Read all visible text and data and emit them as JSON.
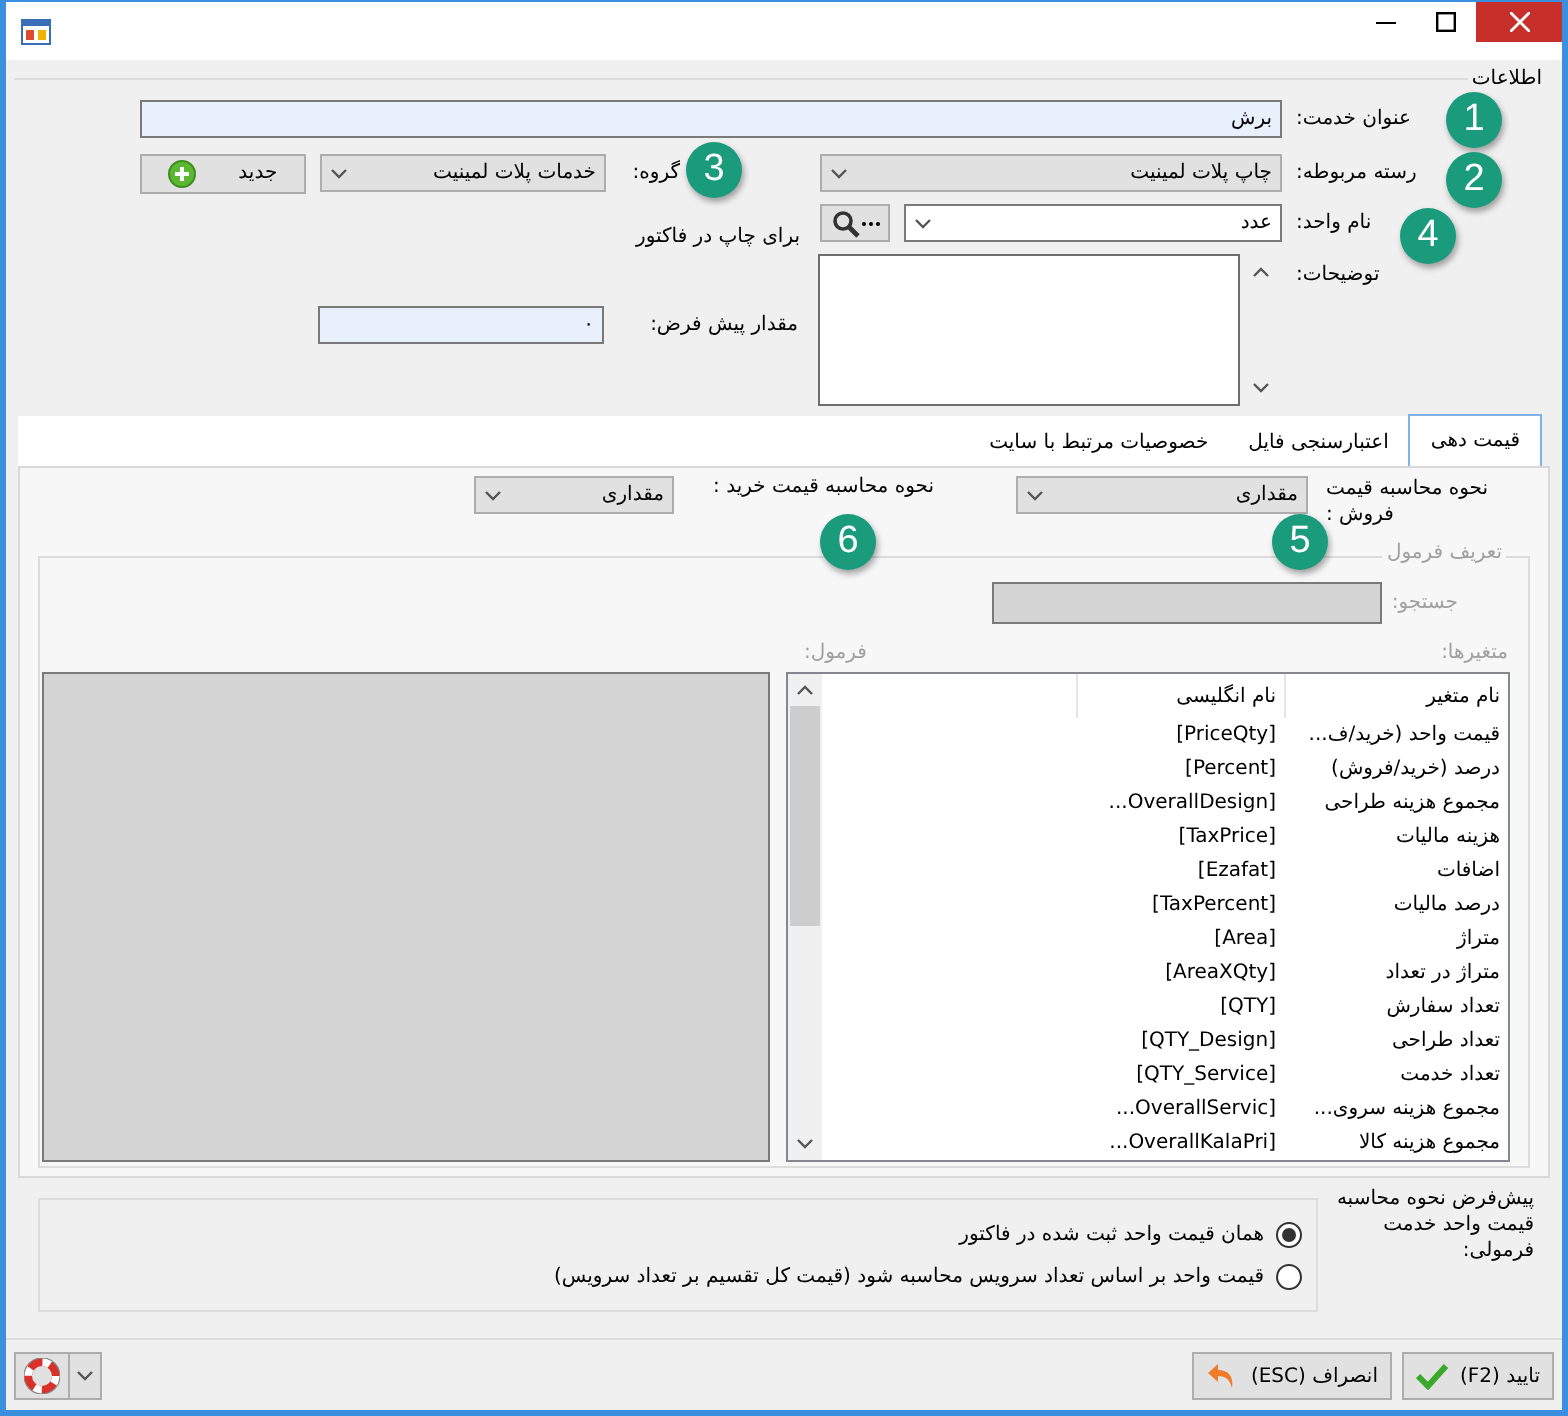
{
  "info_group": {
    "title": "اطلاعات"
  },
  "service_title": {
    "label": "عنوان خدمت:",
    "value": "برش"
  },
  "category": {
    "label": "رسته مربوطه:",
    "value": "چاپ پلات لمینیت",
    "editable": false
  },
  "group": {
    "label": "گروه:",
    "value": "خدمات پلات لمینیت",
    "editable": false
  },
  "new_button": {
    "label": "جدید"
  },
  "unit": {
    "label": "نام واحد:",
    "value": "عدد",
    "editable": true
  },
  "unit_note": "برای چاپ در فاکتور",
  "description": {
    "label": "توضیحات:"
  },
  "default_value": {
    "label": "مقدار پیش فرض:",
    "value": "۰"
  },
  "tabs": [
    {
      "label": "قیمت دهی",
      "selected": true
    },
    {
      "label": "اعتبارسنجی فایل",
      "selected": false
    },
    {
      "label": "خصوصیات مرتبط با سایت",
      "selected": false
    }
  ],
  "pricing": {
    "sale_method": {
      "label": "نحوه محاسبه قیمت فروش :",
      "value": "مقداری",
      "editable": false
    },
    "purchase_method": {
      "label": "نحوه محاسبه قیمت خرید :",
      "value": "مقداری",
      "editable": false
    }
  },
  "formula_group": {
    "title": "تعریف فرمول",
    "disabled": true,
    "search_label": "جستجو:",
    "variables_label": "متغیرها:",
    "formula_label": "فرمول:",
    "columns": [
      "نام متغیر",
      "نام انگلیسی"
    ],
    "rows": [
      {
        "name": "قیمت واحد (خرید/ف...",
        "english": "[PriceQty]"
      },
      {
        "name": "درصد (خرید/فروش)",
        "english": "[Percent]"
      },
      {
        "name": "مجموع هزینه طراحی",
        "english": "[OverallDesign..."
      },
      {
        "name": "هزینه مالیات",
        "english": "[TaxPrice]"
      },
      {
        "name": "اضافات",
        "english": "[Ezafat]"
      },
      {
        "name": "درصد مالیات",
        "english": "[TaxPercent]"
      },
      {
        "name": "متراژ",
        "english": "[Area]"
      },
      {
        "name": "متراژ در تعداد",
        "english": "[AreaXQty]"
      },
      {
        "name": "تعداد سفارش",
        "english": "[QTY]"
      },
      {
        "name": "تعداد طراحی",
        "english": "[QTY_Design]"
      },
      {
        "name": "تعداد خدمت",
        "english": "[QTY_Service]"
      },
      {
        "name": "مجموع هزینه سروی...",
        "english": "[OverallServic..."
      },
      {
        "name": "مجموع هزینه کالا",
        "english": "[OverallKalaPri..."
      }
    ]
  },
  "default_formula_method": {
    "label": "پیش‌فرض نحوه محاسبه قیمت واحد خدمت فرمولی:",
    "options": [
      {
        "label": "همان قیمت واحد ثبت شده در فاکتور",
        "selected": true
      },
      {
        "label": "قیمت واحد بر اساس تعداد سرویس محاسبه شود (قیمت کل تقسیم بر تعداد سرویس)",
        "selected": false
      }
    ]
  },
  "buttons": [
    {
      "label": "تایید (F2)",
      "kind": "confirm"
    },
    {
      "label": "انصراف (ESC)",
      "kind": "cancel"
    }
  ],
  "annotations": [
    "1",
    "2",
    "3",
    "4",
    "5",
    "6"
  ]
}
